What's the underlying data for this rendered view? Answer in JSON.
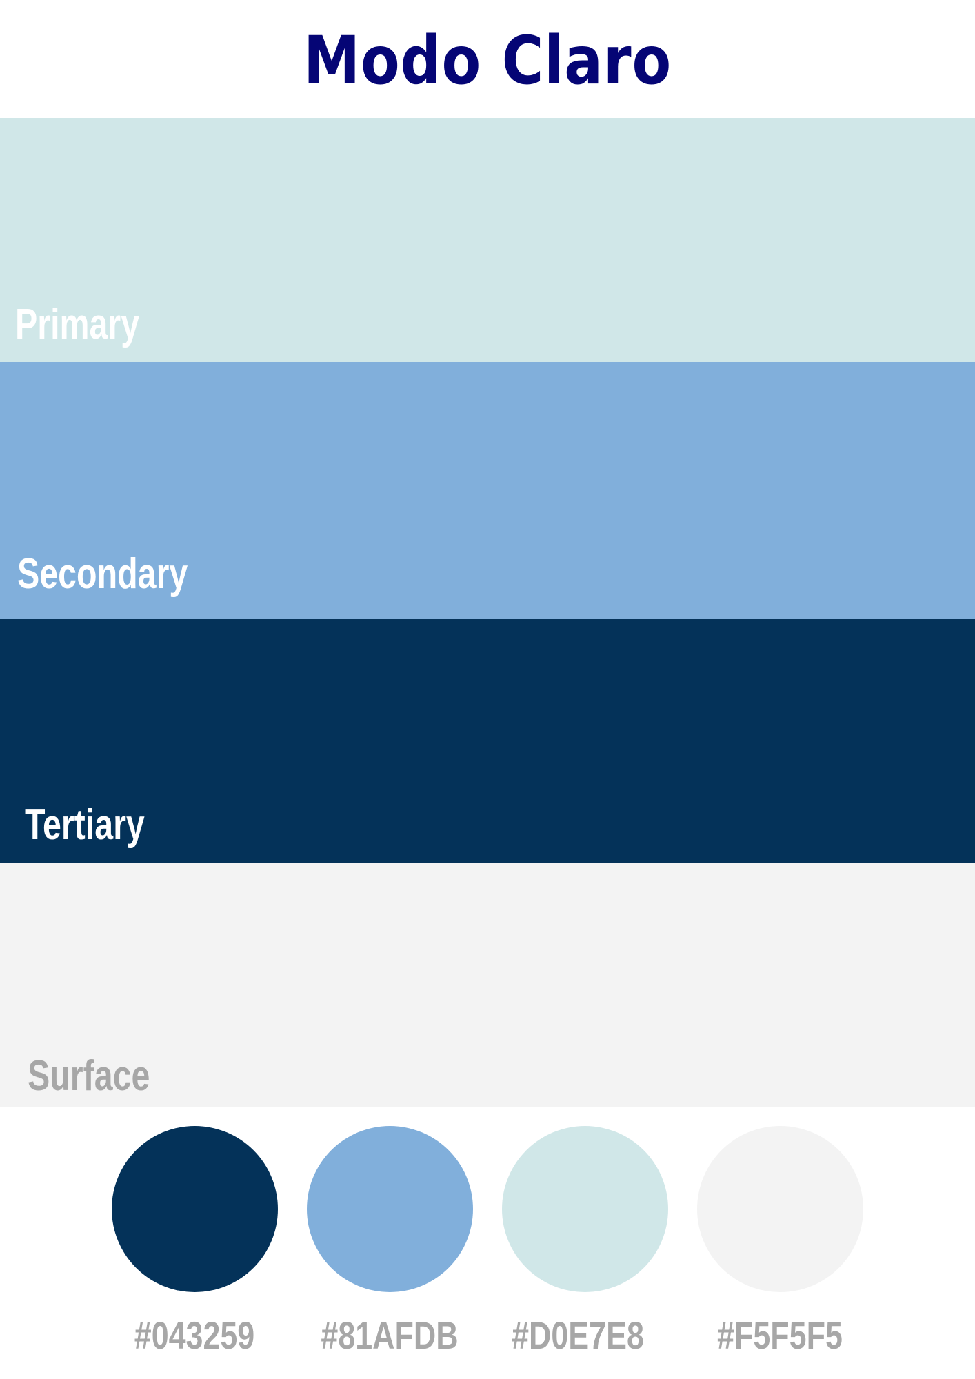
{
  "title": "Modo Claro",
  "bands": [
    {
      "label": "Primary",
      "color": "#d0e7e8",
      "label_color": "#ffffff"
    },
    {
      "label": "Secondary",
      "color": "#81afdb",
      "label_color": "#ffffff"
    },
    {
      "label": "Tertiary",
      "color": "#043259",
      "label_color": "#ffffff"
    },
    {
      "label": "Surface",
      "color": "#f3f3f3",
      "label_color": "#a7a7a7"
    }
  ],
  "swatches": [
    {
      "hex": "#043259",
      "color": "#043259"
    },
    {
      "hex": "#81AFDB",
      "color": "#81afdb"
    },
    {
      "hex": "#D0E7E8",
      "color": "#d0e7e8"
    },
    {
      "hex": "#F5F5F5",
      "color": "#f3f3f3"
    }
  ]
}
